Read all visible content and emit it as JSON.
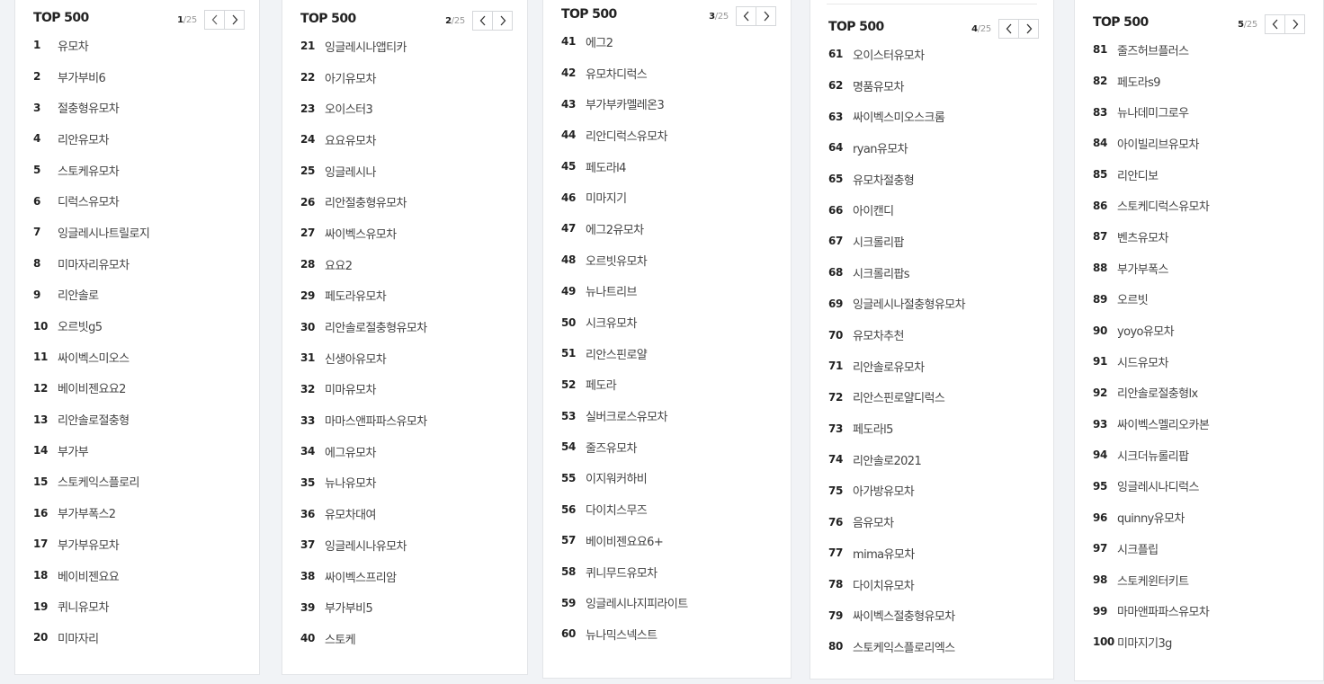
{
  "panels": [
    {
      "title": "TOP 500",
      "page": "1",
      "total": "/25",
      "items": [
        {
          "rank": "1",
          "keyword": "유모차"
        },
        {
          "rank": "2",
          "keyword": "부가부비6"
        },
        {
          "rank": "3",
          "keyword": "절충형유모차"
        },
        {
          "rank": "4",
          "keyword": "리안유모차"
        },
        {
          "rank": "5",
          "keyword": "스토케유모차"
        },
        {
          "rank": "6",
          "keyword": "디럭스유모차"
        },
        {
          "rank": "7",
          "keyword": "잉글레시나트릴로지"
        },
        {
          "rank": "8",
          "keyword": "미마자리유모차"
        },
        {
          "rank": "9",
          "keyword": "리안솔로"
        },
        {
          "rank": "10",
          "keyword": "오르빗g5"
        },
        {
          "rank": "11",
          "keyword": "싸이벡스미오스"
        },
        {
          "rank": "12",
          "keyword": "베이비젠요요2"
        },
        {
          "rank": "13",
          "keyword": "리안솔로절충형"
        },
        {
          "rank": "14",
          "keyword": "부가부"
        },
        {
          "rank": "15",
          "keyword": "스토케익스플로리"
        },
        {
          "rank": "16",
          "keyword": "부가부폭스2"
        },
        {
          "rank": "17",
          "keyword": "부가부유모차"
        },
        {
          "rank": "18",
          "keyword": "베이비젠요요"
        },
        {
          "rank": "19",
          "keyword": "퀴니유모차"
        },
        {
          "rank": "20",
          "keyword": "미마자리"
        }
      ]
    },
    {
      "title": "TOP 500",
      "page": "2",
      "total": "/25",
      "items": [
        {
          "rank": "21",
          "keyword": "잉글레시나앱티카"
        },
        {
          "rank": "22",
          "keyword": "아기유모차"
        },
        {
          "rank": "23",
          "keyword": "오이스터3"
        },
        {
          "rank": "24",
          "keyword": "요요유모차"
        },
        {
          "rank": "25",
          "keyword": "잉글레시나"
        },
        {
          "rank": "26",
          "keyword": "리안절충형유모차"
        },
        {
          "rank": "27",
          "keyword": "싸이벡스유모차"
        },
        {
          "rank": "28",
          "keyword": "요요2"
        },
        {
          "rank": "29",
          "keyword": "페도라유모차"
        },
        {
          "rank": "30",
          "keyword": "리안솔로절충형유모차"
        },
        {
          "rank": "31",
          "keyword": "신생아유모차"
        },
        {
          "rank": "32",
          "keyword": "미마유모차"
        },
        {
          "rank": "33",
          "keyword": "마마스앤파파스유모차"
        },
        {
          "rank": "34",
          "keyword": "에그유모차"
        },
        {
          "rank": "35",
          "keyword": "뉴나유모차"
        },
        {
          "rank": "36",
          "keyword": "유모차대여"
        },
        {
          "rank": "37",
          "keyword": "잉글레시나유모차"
        },
        {
          "rank": "38",
          "keyword": "싸이벡스프리암"
        },
        {
          "rank": "39",
          "keyword": "부가부비5"
        },
        {
          "rank": "40",
          "keyword": "스토케"
        }
      ]
    },
    {
      "title": "TOP 500",
      "page": "3",
      "total": "/25",
      "items": [
        {
          "rank": "41",
          "keyword": "에그2"
        },
        {
          "rank": "42",
          "keyword": "유모차디럭스"
        },
        {
          "rank": "43",
          "keyword": "부가부카멜레온3"
        },
        {
          "rank": "44",
          "keyword": "리안디럭스유모차"
        },
        {
          "rank": "45",
          "keyword": "페도라l4"
        },
        {
          "rank": "46",
          "keyword": "미마지기"
        },
        {
          "rank": "47",
          "keyword": "에그2유모차"
        },
        {
          "rank": "48",
          "keyword": "오르빗유모차"
        },
        {
          "rank": "49",
          "keyword": "뉴나트리브"
        },
        {
          "rank": "50",
          "keyword": "시크유모차"
        },
        {
          "rank": "51",
          "keyword": "리안스핀로얄"
        },
        {
          "rank": "52",
          "keyword": "페도라"
        },
        {
          "rank": "53",
          "keyword": "실버크로스유모차"
        },
        {
          "rank": "54",
          "keyword": "줄즈유모차"
        },
        {
          "rank": "55",
          "keyword": "이지워커하비"
        },
        {
          "rank": "56",
          "keyword": "다이치스무즈"
        },
        {
          "rank": "57",
          "keyword": "베이비젠요요6+"
        },
        {
          "rank": "58",
          "keyword": "퀴니무드유모차"
        },
        {
          "rank": "59",
          "keyword": "잉글레시나지피라이트"
        },
        {
          "rank": "60",
          "keyword": "뉴나믹스넥스트"
        }
      ]
    },
    {
      "title": "TOP 500",
      "page": "4",
      "total": "/25",
      "items": [
        {
          "rank": "61",
          "keyword": "오이스터유모차"
        },
        {
          "rank": "62",
          "keyword": "명품유모차"
        },
        {
          "rank": "63",
          "keyword": "싸이벡스미오스크롬"
        },
        {
          "rank": "64",
          "keyword": "ryan유모차"
        },
        {
          "rank": "65",
          "keyword": "유모차절충형"
        },
        {
          "rank": "66",
          "keyword": "아이캔디"
        },
        {
          "rank": "67",
          "keyword": "시크롤리팝"
        },
        {
          "rank": "68",
          "keyword": "시크롤리팝s"
        },
        {
          "rank": "69",
          "keyword": "잉글레시나절충형유모차"
        },
        {
          "rank": "70",
          "keyword": "유모차추천"
        },
        {
          "rank": "71",
          "keyword": "리안솔로유모차"
        },
        {
          "rank": "72",
          "keyword": "리안스핀로얄디럭스"
        },
        {
          "rank": "73",
          "keyword": "페도라l5"
        },
        {
          "rank": "74",
          "keyword": "리안솔로2021"
        },
        {
          "rank": "75",
          "keyword": "아가방유모차"
        },
        {
          "rank": "76",
          "keyword": "음유모차"
        },
        {
          "rank": "77",
          "keyword": "mima유모차"
        },
        {
          "rank": "78",
          "keyword": "다이치유모차"
        },
        {
          "rank": "79",
          "keyword": "싸이벡스절충형유모차"
        },
        {
          "rank": "80",
          "keyword": "스토케익스플로리엑스"
        }
      ]
    },
    {
      "title": "TOP 500",
      "page": "5",
      "total": "/25",
      "items": [
        {
          "rank": "81",
          "keyword": "줄즈허브플러스"
        },
        {
          "rank": "82",
          "keyword": "페도라s9"
        },
        {
          "rank": "83",
          "keyword": "뉴나데미그로우"
        },
        {
          "rank": "84",
          "keyword": "아이빌리브유모차"
        },
        {
          "rank": "85",
          "keyword": "리안디보"
        },
        {
          "rank": "86",
          "keyword": "스토케디럭스유모차"
        },
        {
          "rank": "87",
          "keyword": "벤츠유모차"
        },
        {
          "rank": "88",
          "keyword": "부가부폭스"
        },
        {
          "rank": "89",
          "keyword": "오르빗"
        },
        {
          "rank": "90",
          "keyword": "yoyo유모차"
        },
        {
          "rank": "91",
          "keyword": "시드유모차"
        },
        {
          "rank": "92",
          "keyword": "리안솔로절충형lx"
        },
        {
          "rank": "93",
          "keyword": "싸이벡스멜리오카본"
        },
        {
          "rank": "94",
          "keyword": "시크더뉴롤리팝"
        },
        {
          "rank": "95",
          "keyword": "잉글레시나디럭스"
        },
        {
          "rank": "96",
          "keyword": "quinny유모차"
        },
        {
          "rank": "97",
          "keyword": "시크플립"
        },
        {
          "rank": "98",
          "keyword": "스토케윈터키트"
        },
        {
          "rank": "99",
          "keyword": "마마앤파파스유모차"
        },
        {
          "rank": "100",
          "keyword": "미마지기3g"
        }
      ]
    }
  ]
}
